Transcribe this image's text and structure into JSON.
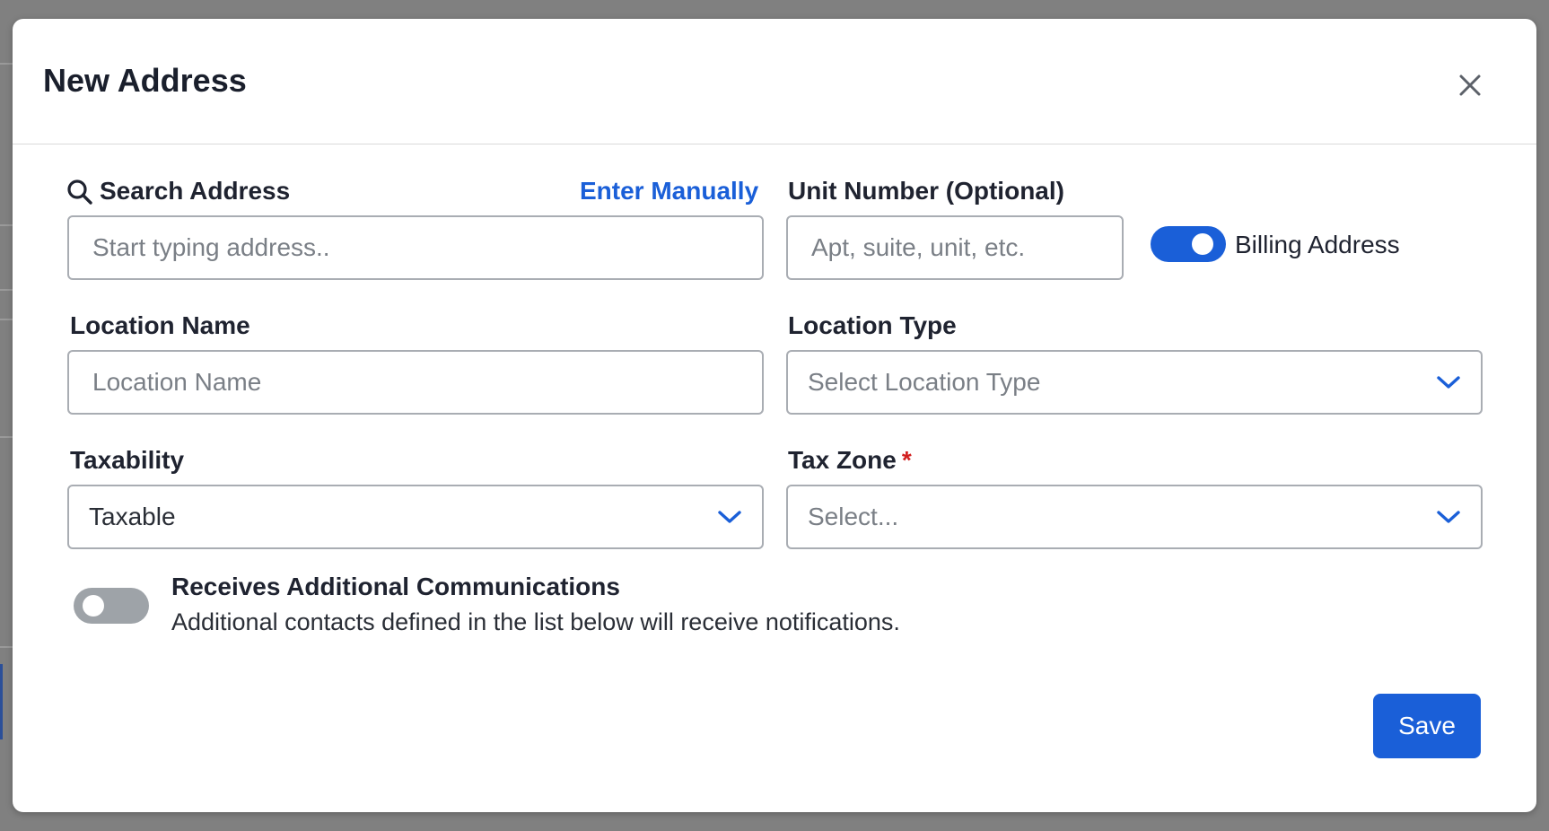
{
  "modal": {
    "title": "New Address",
    "close_label": "Close"
  },
  "search_address": {
    "label": "Search Address",
    "enter_manually": "Enter Manually",
    "placeholder": "Start typing address.."
  },
  "unit_number": {
    "label": "Unit Number (Optional)",
    "placeholder": "Apt, suite, unit, etc."
  },
  "billing_address": {
    "label": "Billing Address",
    "on": true
  },
  "location_name": {
    "label": "Location Name",
    "placeholder": "Location Name"
  },
  "location_type": {
    "label": "Location Type",
    "placeholder": "Select Location Type"
  },
  "taxability": {
    "label": "Taxability",
    "value": "Taxable"
  },
  "tax_zone": {
    "label": "Tax Zone",
    "required_mark": "*",
    "placeholder": "Select..."
  },
  "additional_comms": {
    "title": "Receives Additional Communications",
    "description": "Additional contacts defined in the list below will receive notifications.",
    "on": false
  },
  "save_button": "Save",
  "colors": {
    "accent": "#1a5fd8",
    "required": "#d21f1f",
    "toggle_off": "#9ea3a8"
  },
  "icons": {
    "search": "search-icon",
    "close": "close-icon",
    "chevron": "chevron-down-icon"
  }
}
